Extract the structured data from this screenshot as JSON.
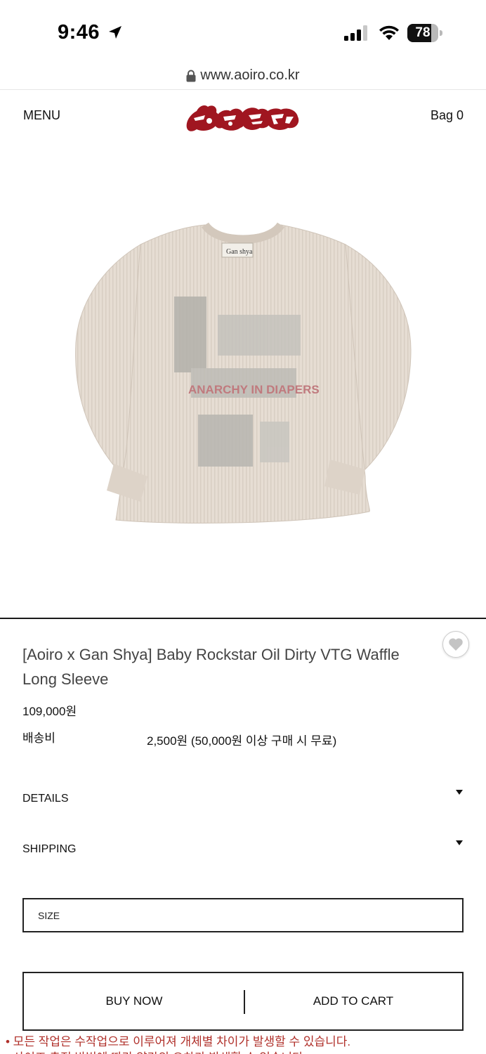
{
  "status_bar": {
    "time": "9:46",
    "battery": "78",
    "battery_level": 0.78
  },
  "browser": {
    "url": "www.aoiro.co.kr"
  },
  "header": {
    "menu_label": "MENU",
    "bag_label": "Bag 0",
    "logo_color": "#a01620"
  },
  "product": {
    "print_text": "ANARCHY IN DIAPERS",
    "collar_tag": "Gan shya",
    "title": "[Aoiro x Gan Shya] Baby Rockstar Oil Dirty VTG Waffle Long Sleeve",
    "price": "109,000원",
    "shipping_label": "배송비",
    "shipping_value": "2,500원 (50,000원 이상 구매 시 무료)"
  },
  "accordions": [
    {
      "label": "DETAILS"
    },
    {
      "label": "SHIPPING"
    }
  ],
  "size_select": {
    "label": "SIZE"
  },
  "actions": {
    "buy_now": "BUY NOW",
    "add_to_cart": "ADD TO CART"
  },
  "notices": [
    "• 모든 작업은 수작업으로 이루어져 개체별 차이가 발생할 수 있습니다.",
    "• 사이즈 측정 방법에 따라 약간의 오차가 발생할 수 있습니다."
  ],
  "colors": {
    "notice": "#b0302a",
    "accent_dark": "#222222"
  },
  "icons": {
    "location": "location-arrow-icon",
    "signal": "cellular-signal-icon",
    "wifi": "wifi-icon",
    "battery": "battery-icon",
    "lock": "lock-icon",
    "wishlist": "heart-icon",
    "caret": "caret-down-icon"
  }
}
